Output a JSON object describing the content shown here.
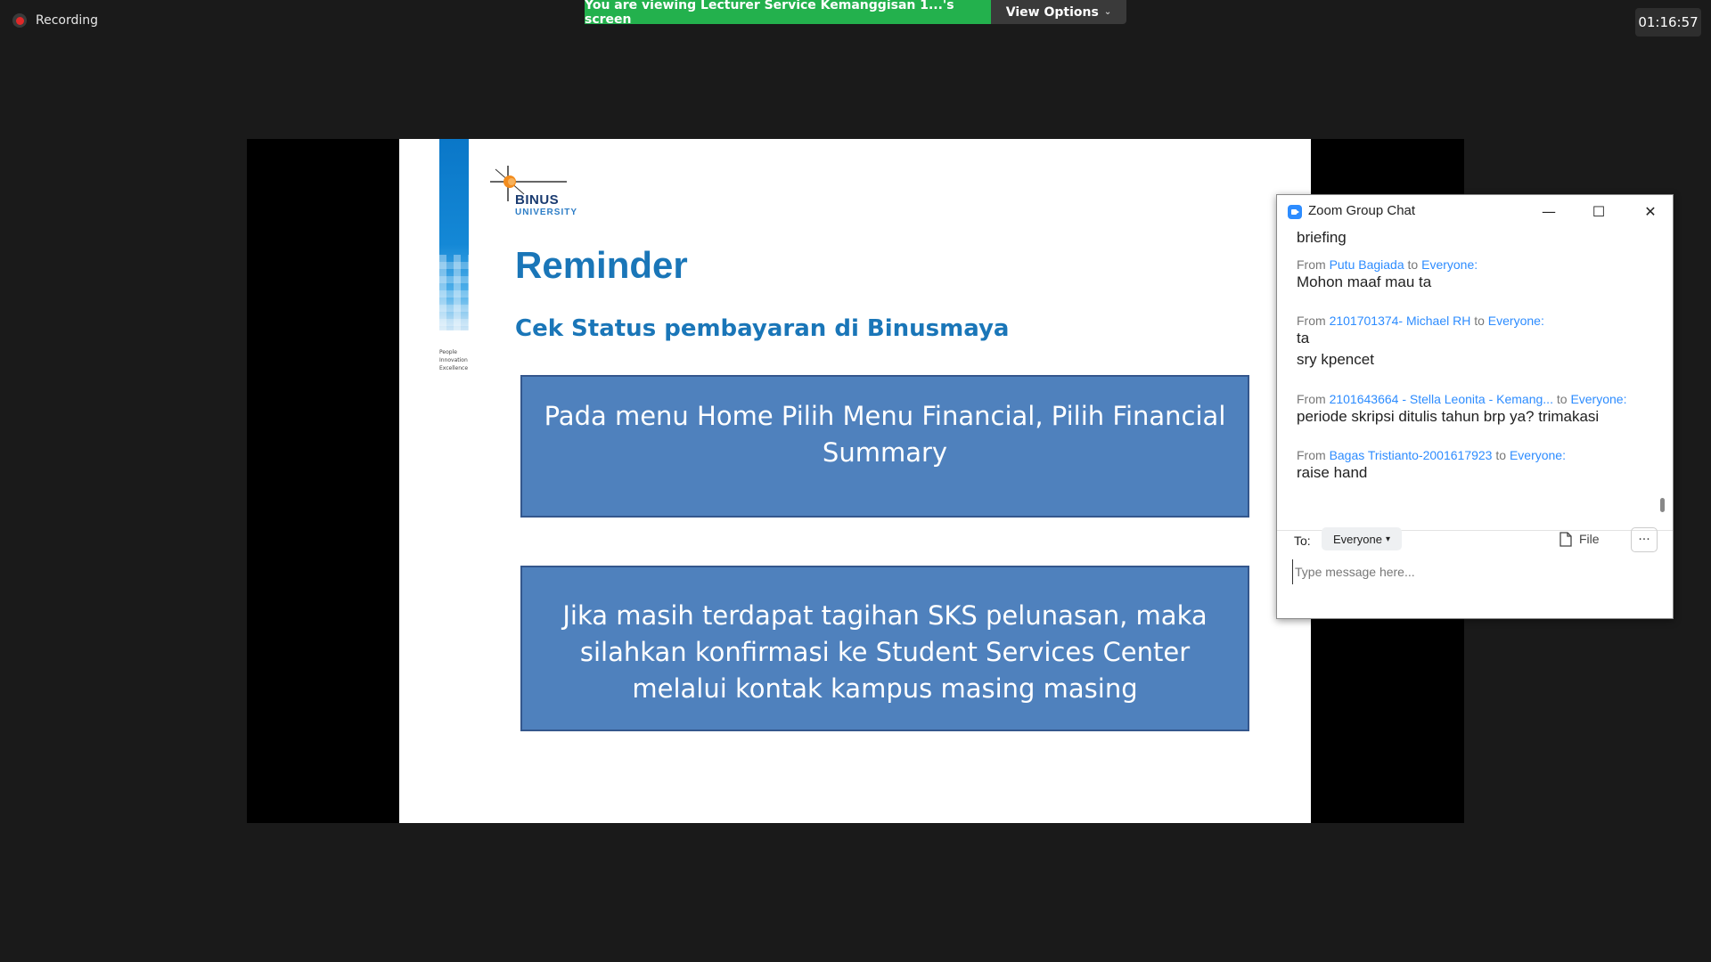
{
  "top": {
    "recording_label": "Recording",
    "viewing_text": "You are viewing Lecturer Service Kemanggisan 1...'s screen",
    "view_options_label": "View Options",
    "timer": "01:16:57"
  },
  "slide": {
    "logo_name": "BINUS",
    "logo_sub": "UNIVERSITY",
    "tagline": [
      "People",
      "Innovation",
      "Excellence"
    ],
    "title": "Reminder",
    "subtitle": "Cek Status pembayaran di Binusmaya",
    "box1": "Pada menu Home Pilih Menu Financial, Pilih Financial Summary",
    "box2": "Jika masih terdapat tagihan SKS pelunasan, maka silahkan konfirmasi ke Student Services Center melalui kontak kampus masing masing",
    "colors": {
      "title": "#1a76b8",
      "box": "#4f81bd",
      "box_border": "#34578d"
    }
  },
  "chat": {
    "title": "Zoom Group Chat",
    "controls": {
      "minimize": "—",
      "maximize": "☐",
      "close": "✕"
    },
    "partial_message": "briefing",
    "messages": [
      {
        "from_prefix": "From",
        "sender": "Putu Bagiada",
        "to": "to",
        "recipient": "Everyone:",
        "lines": [
          "Mohon maaf mau ta"
        ]
      },
      {
        "from_prefix": "From",
        "sender": "2101701374- Michael RH",
        "to": "to",
        "recipient": "Everyone:",
        "lines": [
          "ta",
          "sry kpencet"
        ]
      },
      {
        "from_prefix": "From",
        "sender": "2101643664 - Stella Leonita - Kemang...",
        "to": "to",
        "recipient": "Everyone:",
        "lines": [
          "periode skripsi ditulis tahun brp ya? trimakasi"
        ]
      },
      {
        "from_prefix": "From",
        "sender": "Bagas Tristianto-2001617923",
        "to": "to",
        "recipient": "Everyone:",
        "lines": [
          "raise hand"
        ]
      }
    ],
    "to_label": "To:",
    "to_value": "Everyone",
    "file_label": "File",
    "more_label": "···",
    "input_placeholder": "Type message here...",
    "accent": "#2d8cff"
  }
}
